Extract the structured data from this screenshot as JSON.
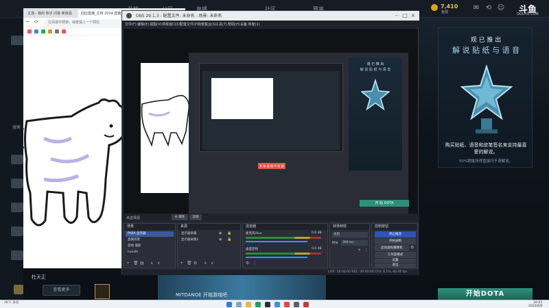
{
  "background_site": {
    "nav": [
      "英雄",
      "分区",
      "直播",
      "社区",
      "赛事"
    ],
    "coin_value": "7,410",
    "coin_sub": "鱼翅",
    "logo_mark": "斗鱼",
    "logo_text": "DOUYU.COM",
    "search_label": "搜索",
    "user_name": "杜天正",
    "viewer_button": "查看更多",
    "bottom_banner_text": "MITDANOE 开始游戏吧",
    "icons": [
      "coin-icon",
      "gift-icon",
      "message-icon",
      "history-icon",
      "user-icon"
    ]
  },
  "promo": {
    "title": "观 已 推 出",
    "subtitle": "解 说 贴 纸 与 语 音",
    "description": "购买贴纸、语音和皮笔签名来支持最喜爱的解说。",
    "note": "50%销售所得直接归于该解说。",
    "button": "开始DOTA"
  },
  "browser": {
    "tab1": "主场 - 我的 知乎 问答 新体验",
    "tab2": "回应直播_主持 2024 直播_主播 官",
    "address": "在百度中搜索，或者输入一个网址"
  },
  "obs": {
    "title": "OBS 29.1.3 - 配置文件: 未命名 - 场景: 未命名",
    "menu": [
      "文件(F)",
      "编辑(E)",
      "视图(V)",
      "停靠窗口(D)",
      "配置文件(P)",
      "场景集合(S)",
      "工具(T)",
      "帮助(H)",
      "设备·热度(1)"
    ],
    "preview": {
      "promo_title": "观 已 推 出",
      "promo_sub": "解 说 贴 纸 与 语 音",
      "red_button": "开 始 直 播 中 奖 励",
      "promo_button": "开 始 DOTA"
    },
    "source_bar": {
      "current_source": "未选择源",
      "properties": "⚙ 属性",
      "filters": "滤镜"
    },
    "scenes": {
      "title": "场景",
      "items": [
        "PARA 显示器",
        "直播场景",
        "游戏 捕获",
        "hxkdfk"
      ]
    },
    "sources": {
      "title": "来源",
      "items": [
        "显示器采集",
        "显示器采集1"
      ]
    },
    "mixer": {
      "title": "混音器",
      "channels": [
        {
          "name": "麦克风/Aux",
          "db": "0.0 dB"
        },
        {
          "name": "桌面音频",
          "db": "0.0 dB"
        }
      ]
    },
    "transitions": {
      "title": "转场特效",
      "type": "淡出",
      "duration_label": "时长",
      "duration": "300 ms"
    },
    "controls": {
      "title": "控制按钮",
      "buttons": [
        "停止推流",
        "开始录制",
        "启动虚拟摄像机",
        "工作室模式",
        "设置",
        "退出"
      ]
    },
    "status": "LIVE: 00:00:00   REC: 00:00:00   CPU: 6.1%, 60.00 fps"
  },
  "taskbar": {
    "weather": "26°C 多云",
    "time": "20:05",
    "date": "2024/6/8"
  },
  "colors": {
    "obs_accent": "#2d54b8",
    "promo_button": "#2f8f7c",
    "coin": "#e3a21a"
  }
}
